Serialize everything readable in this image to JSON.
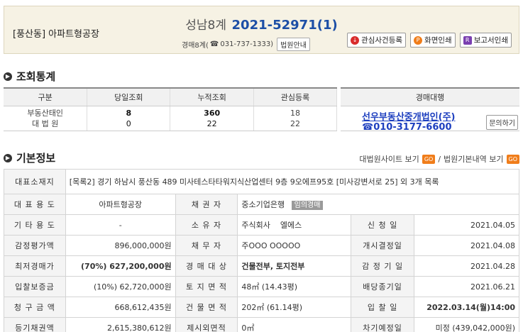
{
  "header": {
    "location": "[풍산동] 아파트형공장",
    "court": "성남8계",
    "case_no": "2021-52971(1)",
    "sub_prefix": "경매8계(",
    "phone": "031-737-1333)",
    "court_guide_btn": "법원안내",
    "buttons": [
      "관심사건등록",
      "화면인쇄",
      "보고서인쇄"
    ]
  },
  "stats_section": {
    "title": "조회통계",
    "headers": [
      "구분",
      "당일조회",
      "누적조회",
      "관심등록"
    ],
    "rows": [
      {
        "label": "부동산태인",
        "today": "8",
        "total": "360",
        "interest": "18"
      },
      {
        "label": "대 법 원",
        "today": "0",
        "total": "22",
        "interest": "22"
      }
    ],
    "agent_header": "경매대행",
    "agent_name": "선우부동산중개법인(주)",
    "agent_phone": "☎010-3177-6600",
    "inquiry_btn": "문의하기"
  },
  "info_section": {
    "title": "기본정보",
    "link1": "대법원사이트 보기",
    "link_sep": "/",
    "link2": "법원기본내역 보기",
    "go": "GO",
    "address_label": "대표소재지",
    "address": "[목록2] 경기 하남시 풍산동 489 미사테스타타워지식산업센터 9층 9오에프95호 [미사강변서로 25] 외 3개 목록",
    "rows": [
      {
        "l1": "대 표 용 도",
        "v1": "아파트형공장",
        "l2": "채 권 자",
        "v2": "중소기업은행",
        "badge": "임의경매",
        "l3": "",
        "v3": ""
      },
      {
        "l1": "기 타 용 도",
        "v1": "-",
        "l2": "소 유 자",
        "v2": "주식회사    엘에스",
        "l3": "신 청 일",
        "v3": "2021.04.05"
      },
      {
        "l1": "감정평가액",
        "v1": "896,000,000원",
        "l2": "채 무 자",
        "v2": "주OOO OOOOO",
        "l3": "개시결정일",
        "v3": "2021.04.08"
      },
      {
        "l1": "최저경매가",
        "v1": "(70%) 627,200,000원",
        "l2": "경 매 대 상",
        "v2": "건물전부, 토지전부",
        "l3": "감 정 기 일",
        "v3": "2021.04.28"
      },
      {
        "l1": "입찰보증금",
        "v1": "(10%) 62,720,000원",
        "l2": "토 지 면 적",
        "v2": "48㎡ (14.43평)",
        "l3": "배당종기일",
        "v3": "2021.06.21"
      },
      {
        "l1": "청 구 금 액",
        "v1": "668,612,435원",
        "l2": "건 물 면 적",
        "v2": "202㎡ (61.14평)",
        "l3": "입 찰 일",
        "v3": "2022.03.14(월)14:00"
      },
      {
        "l1": "등기채권액",
        "v1": "2,615,380,612원",
        "l2": "제시외면적",
        "v2": "0㎡",
        "l3": "차기예정일",
        "v3": "미정 (439,042,000원)"
      }
    ]
  }
}
